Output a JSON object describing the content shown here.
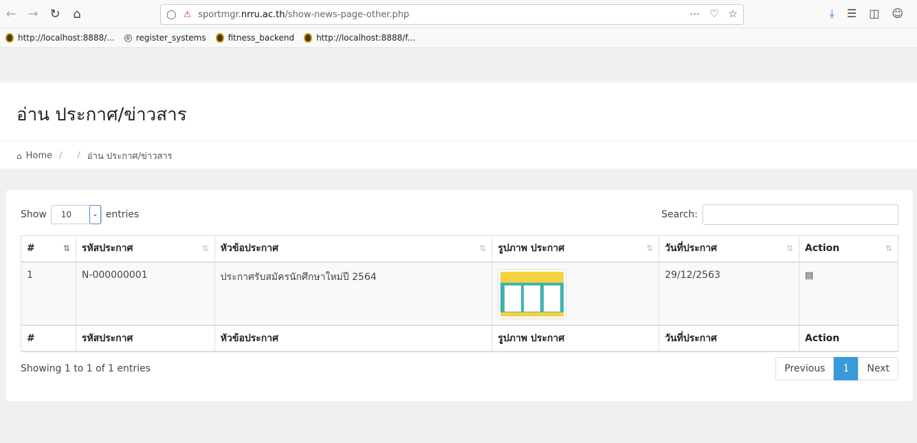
{
  "browser": {
    "url_prefix": "sportmgr.",
    "url_domain": "nrru.ac.th",
    "url_path": "/show-news-page-other.php",
    "bookmarks": [
      {
        "label": "http://localhost:8888/..."
      },
      {
        "label": "register_systems"
      },
      {
        "label": "fitness_backend"
      },
      {
        "label": "http://localhost:8888/f..."
      }
    ]
  },
  "header": {
    "title": "อ่าน ประกาศ/ข่าวสาร",
    "breadcrumb_home": "Home",
    "breadcrumb_sep1": "/",
    "breadcrumb_sep2": "/",
    "breadcrumb_current": "อ่าน ประกาศ/ข่าวสาร"
  },
  "table_controls": {
    "show_label": "Show",
    "entries_label": "entries",
    "page_length": "10",
    "search_label": "Search:"
  },
  "table": {
    "columns": [
      "#",
      "รหัสประกาศ",
      "หัวข้อประกาศ",
      "รูปภาพ ประกาศ",
      "วันที่ประกาศ",
      "Action"
    ],
    "rows": [
      {
        "num": "1",
        "code": "N-000000001",
        "title": "ประกาศรับสมัครนักศึกษาใหม่ปี 2564",
        "date": "29/12/2563"
      }
    ]
  },
  "footer": {
    "info": "Showing 1 to 1 of 1 entries",
    "previous": "Previous",
    "current_page": "1",
    "next": "Next"
  }
}
